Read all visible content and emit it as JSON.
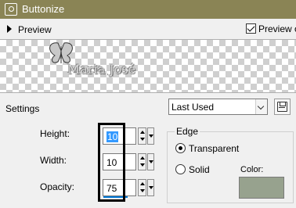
{
  "window": {
    "title": "Buttonize"
  },
  "preview": {
    "toggle_label": "Preview",
    "checkbox_label": "Preview o",
    "checkbox_checked": true
  },
  "watermark": {
    "text": "Maria José"
  },
  "settings": {
    "label": "Settings",
    "preset_value": "Last Used"
  },
  "fields": {
    "height": {
      "label": "Height:",
      "value": "10"
    },
    "width": {
      "label": "Width:",
      "value": "10"
    },
    "opacity": {
      "label": "Opacity:",
      "value": "75",
      "level": 0.75
    }
  },
  "edge": {
    "title": "Edge",
    "options": [
      {
        "label": "Transparent",
        "selected": true
      },
      {
        "label": "Solid",
        "selected": false
      }
    ],
    "color_label": "Color:",
    "color": "#97a28e"
  },
  "colors": {
    "titlebar": "#8a8455",
    "selection": "#3399ff",
    "accent": "#0078d7"
  },
  "icons": {
    "app": "camera-icon",
    "expand": "triangle-right-icon",
    "save": "disk-icon",
    "watermark": "butterfly-icon"
  }
}
